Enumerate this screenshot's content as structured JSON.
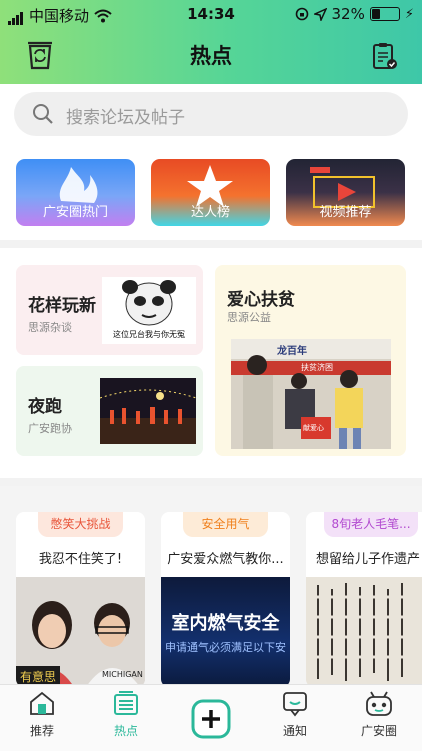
{
  "status_bar": {
    "carrier": "中国移动",
    "time": "14:34",
    "battery": "32%"
  },
  "nav": {
    "title": "热点",
    "left_icon": "recycle-bin-icon",
    "right_icon": "clipboard-check-icon"
  },
  "search": {
    "placeholder": "搜索论坛及帖子"
  },
  "quick_links": [
    {
      "label": "广安圈热门",
      "icon": "flame-icon"
    },
    {
      "label": "达人榜",
      "icon": "star-icon"
    },
    {
      "label": "视频推荐",
      "icon": "play-icon"
    }
  ],
  "forums": {
    "huayang": {
      "title": "花样玩新",
      "sub": "思源杂谈",
      "meme_caption": "这位兄台我与你无冤"
    },
    "yepao": {
      "title": "夜跑",
      "sub": "广安跑协"
    },
    "aixin": {
      "title": "爱心扶贫",
      "sub": "思源公益",
      "photo_banner": "龙百年",
      "photo_banner2": "扶贫济困",
      "photo_box": "献爱心"
    }
  },
  "hot_posts": [
    {
      "tag": "憋笑大挑战",
      "tag_color": "#fde7dd",
      "tag_text_color": "#e8553a",
      "title": "我忍不住笑了!",
      "overlay": "有意思"
    },
    {
      "tag": "安全用气",
      "tag_color": "#fdebd7",
      "tag_text_color": "#f0811e",
      "title": "广安爱众燃气教你...",
      "img_text1": "室内燃气安全",
      "img_text2": "申请通气必须满足以下安"
    },
    {
      "tag": "8旬老人毛笔...",
      "tag_color": "#f3e1f8",
      "tag_text_color": "#b24ad0",
      "title": "想留给儿子作遗产"
    }
  ],
  "tabs": [
    {
      "label": "推荐",
      "icon": "home-icon",
      "active": false
    },
    {
      "label": "热点",
      "icon": "hot-list-icon",
      "active": true
    },
    {
      "label": "",
      "icon": "plus-icon",
      "active": false
    },
    {
      "label": "通知",
      "icon": "message-icon",
      "active": false
    },
    {
      "label": "广安圈",
      "icon": "robot-face-icon",
      "active": false
    }
  ],
  "colors": {
    "accent": "#2bb89a",
    "header_start": "#8fe07a",
    "header_end": "#3ec7a8"
  }
}
